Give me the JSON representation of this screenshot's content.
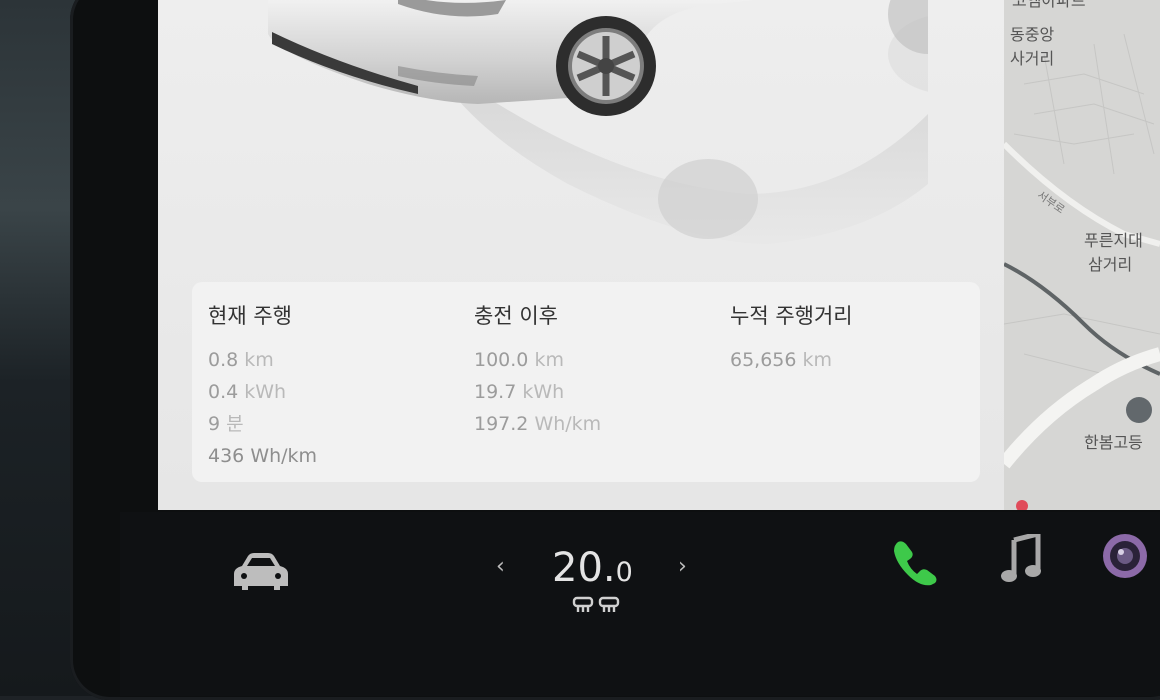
{
  "stats": {
    "current": {
      "title": "현재 주행",
      "rows": [
        {
          "value": "0.8",
          "unit": "km"
        },
        {
          "value": "0.4",
          "unit": "kWh"
        },
        {
          "value": "9",
          "unit": "분"
        },
        {
          "value": "436",
          "unit": "Wh/km"
        }
      ]
    },
    "since_charge": {
      "title": "충전 이후",
      "rows": [
        {
          "value": "100.0",
          "unit": "km"
        },
        {
          "value": "19.7",
          "unit": "kWh"
        },
        {
          "value": "197.2",
          "unit": "Wh/km"
        }
      ]
    },
    "odometer": {
      "title": "누적 주행거리",
      "rows": [
        {
          "value": "65,656",
          "unit": "km"
        }
      ]
    }
  },
  "map": {
    "labels": {
      "top": "코엠아파트",
      "l1": "동중앙",
      "l2": "사거리",
      "road": "서부로",
      "l3": "푸른지대",
      "l4": "삼거리",
      "school": "한봄고등"
    }
  },
  "climate": {
    "temp_int": "20.",
    "temp_dec": "0"
  },
  "icons": {
    "car": "car-icon",
    "phone": "phone-icon",
    "music": "music-icon",
    "camera": "camera-icon",
    "seat_heat": "seat-heater-icon",
    "phone_color": "#3ec94a"
  }
}
